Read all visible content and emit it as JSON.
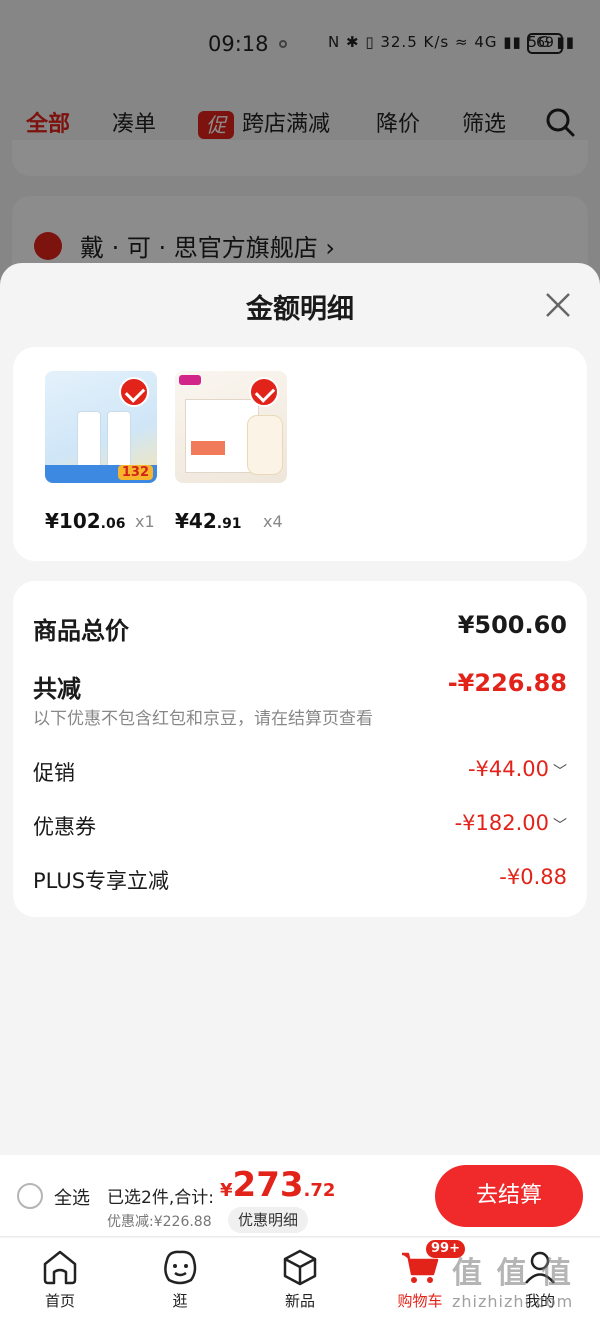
{
  "status_bar": {
    "time": "09:18",
    "network_icons": "N ✱ ▯ 32.5 K/s ≈ 4G ▮▮ 5G ▮▮",
    "battery": "69"
  },
  "top_tabs": [
    {
      "label": "全部",
      "active": true
    },
    {
      "label": "凑单"
    },
    {
      "label": "跨店满减",
      "badge": "促"
    },
    {
      "label": "降价"
    },
    {
      "label": "筛选"
    }
  ],
  "store": {
    "name": "戴 · 可 · 思官方旗舰店 ›"
  },
  "sheet": {
    "title": "金额明细",
    "products": [
      {
        "image": "skincare-lotion-product",
        "tag_price": "132",
        "price_int": "¥102",
        "price_dec": ".06",
        "qty": "x1"
      },
      {
        "image": "diaper-pack-product",
        "price_int": "¥42",
        "price_dec": ".91",
        "qty": "x4"
      }
    ],
    "summary": {
      "total_label": "商品总价",
      "total_value": "¥500.60",
      "discount_label": "共减",
      "discount_value": "-¥226.88",
      "note": "以下优惠不包含红包和京豆，请在结算页查看",
      "items": [
        {
          "label": "促销",
          "value": "-¥44.00",
          "expandable": true
        },
        {
          "label": "优惠券",
          "value": "-¥182.00",
          "expandable": true
        },
        {
          "label": "PLUS专享立减",
          "value": "-¥0.88",
          "expandable": false
        }
      ]
    }
  },
  "checkout": {
    "select_all": "全选",
    "selected_text": "已选2件,合计:",
    "total_cur": "¥",
    "total_int": "273",
    "total_dec": ".72",
    "discount_text": "优惠减:¥226.88",
    "detail_button": "优惠明细",
    "checkout_button": "去结算"
  },
  "tab_bar": [
    {
      "label": "首页",
      "icon": "home-icon"
    },
    {
      "label": "逛",
      "icon": "discover-face-icon"
    },
    {
      "label": "新品",
      "icon": "new-box-icon"
    },
    {
      "label": "购物车",
      "icon": "cart-icon",
      "badge": "99+",
      "active": true
    },
    {
      "label": "我的",
      "icon": "profile-icon"
    }
  ],
  "watermark": {
    "main": "值 值 值",
    "sub": "zhizhizhi.com"
  },
  "colors": {
    "accent": "#e2231a",
    "checkout_button": "#f02a2a",
    "background": "#f4f4f4"
  }
}
